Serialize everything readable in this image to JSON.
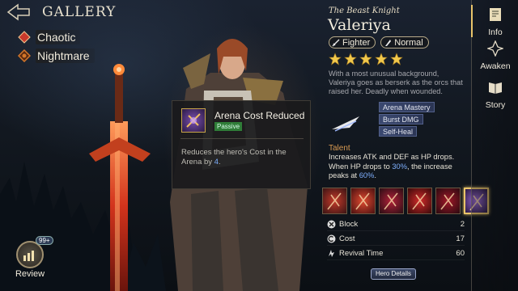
{
  "header": {
    "title": "GALLERY"
  },
  "filters": [
    {
      "label": "Chaotic",
      "icon": "chaotic-icon",
      "color": "#c83a2c"
    },
    {
      "label": "Nightmare",
      "icon": "nightmare-icon",
      "color": "#d4772a"
    }
  ],
  "review": {
    "label": "Review",
    "badge": "99+"
  },
  "hero": {
    "subtitle": "The Beast Knight",
    "name": "Valeriya",
    "role": "Fighter",
    "rarity": "Normal",
    "stars": 5,
    "description": "With a most unusual background, Valeriya goes as berserk as the orcs that raised her. Deadly when wounded.",
    "skill_tags": [
      "Arena Mastery",
      "Burst DMG",
      "Self-Heal"
    ],
    "talent_label": "Talent",
    "talent_text_1": "Increases ATK and DEF as HP drops. When HP drops to ",
    "talent_hl_1": "30%",
    "talent_text_2": ", the increase peaks at ",
    "talent_hl_2": "60%",
    "talent_text_3": ".",
    "skills": [
      "skill-1",
      "skill-2",
      "skill-3",
      "skill-4",
      "skill-5",
      "skill-6"
    ],
    "selected_skill": 5
  },
  "stats": [
    {
      "label": "Block",
      "value": "2",
      "icon": "block-icon"
    },
    {
      "label": "Cost",
      "value": "17",
      "icon": "cost-icon"
    },
    {
      "label": "Revival Time",
      "value": "60",
      "icon": "revival-time-icon"
    }
  ],
  "hero_details_label": "Hero Details",
  "sidebar": [
    {
      "label": "Info",
      "icon": "info-book-icon",
      "active": true
    },
    {
      "label": "Awaken",
      "icon": "awaken-icon",
      "active": false
    },
    {
      "label": "Story",
      "icon": "story-book-icon",
      "active": false
    }
  ],
  "tooltip": {
    "title": "Arena Cost Reduced",
    "badge": "Passive",
    "desc_text": "Reduces the hero's Cost in the Arena by ",
    "desc_value": "4",
    "desc_end": "."
  },
  "colors": {
    "accent_gold": "#e9c46a",
    "highlight_blue": "#7fb0ff",
    "talent_orange": "#d89a52",
    "passive_green": "#2f7d38"
  }
}
